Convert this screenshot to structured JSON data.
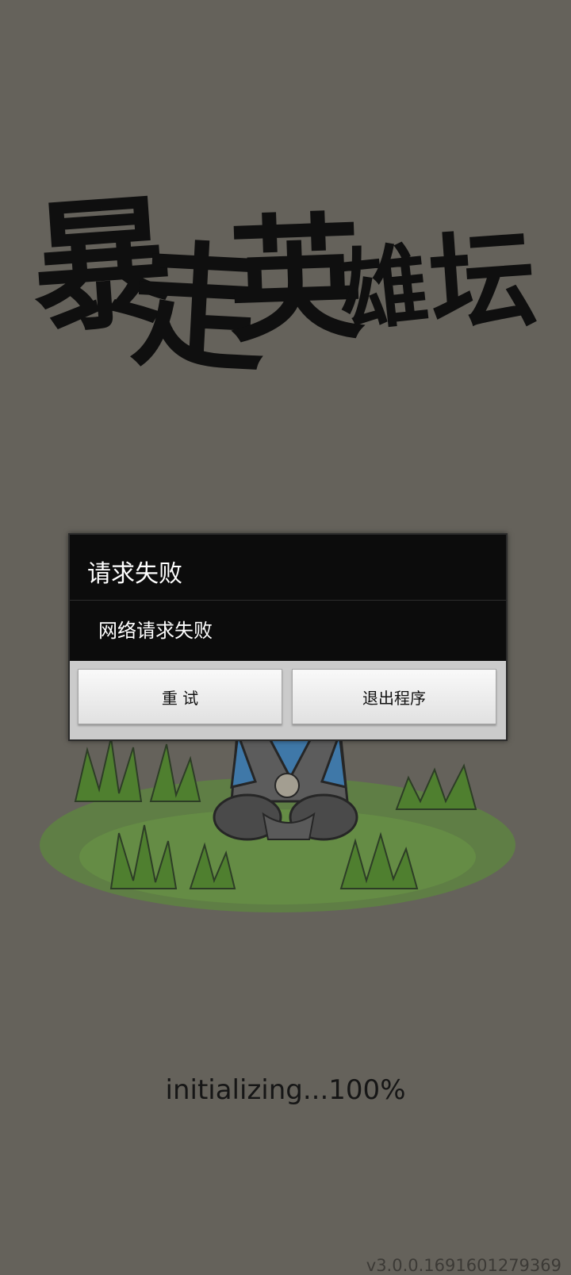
{
  "logo": {
    "alt": "暴走英雄坛",
    "chars": [
      "暴",
      "走",
      "英",
      "雄",
      "坛"
    ]
  },
  "dialog": {
    "title": "请求失败",
    "message": "网络请求失败",
    "retry_label": "重 试",
    "exit_label": "退出程序"
  },
  "status": {
    "loading_text": "initializing...100%"
  },
  "footer": {
    "version": "v3.0.0.1691601279369"
  },
  "colors": {
    "background": "#65625b",
    "dialog_dark": "#0c0c0c",
    "button_light": "#ececec",
    "grass": "#5c8a3a"
  }
}
